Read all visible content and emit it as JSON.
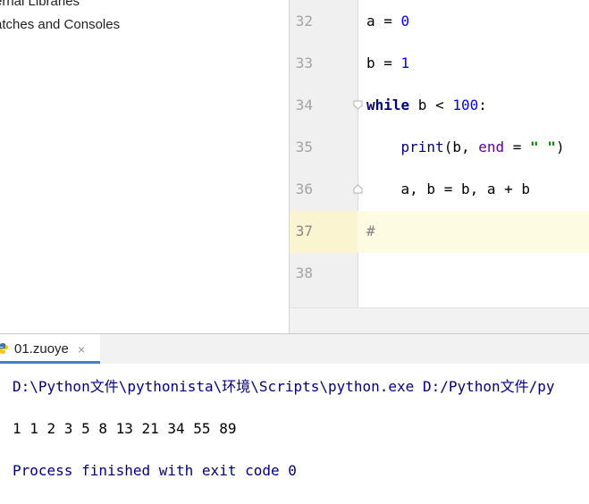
{
  "project_panel": {
    "items": [
      {
        "label": "ernal Libraries"
      },
      {
        "label": "atches and Consoles"
      }
    ]
  },
  "editor": {
    "lines": [
      {
        "number": "32",
        "tokens": [
          {
            "t": "a = ",
            "c": ""
          },
          {
            "t": "0",
            "c": "num"
          }
        ]
      },
      {
        "number": "33",
        "tokens": [
          {
            "t": "b = ",
            "c": ""
          },
          {
            "t": "1",
            "c": "num"
          }
        ]
      },
      {
        "number": "34",
        "tokens": [
          {
            "t": "while",
            "c": "kw"
          },
          {
            "t": " b < ",
            "c": ""
          },
          {
            "t": "100",
            "c": "num"
          },
          {
            "t": ":",
            "c": ""
          }
        ]
      },
      {
        "number": "35",
        "tokens": [
          {
            "t": "    ",
            "c": ""
          },
          {
            "t": "print",
            "c": "bi"
          },
          {
            "t": "(b, ",
            "c": ""
          },
          {
            "t": "end",
            "c": "kwarg"
          },
          {
            "t": " = ",
            "c": ""
          },
          {
            "t": "\" \"",
            "c": "str"
          },
          {
            "t": ")",
            "c": ""
          }
        ]
      },
      {
        "number": "36",
        "tokens": [
          {
            "t": "    a, b = b, a + b",
            "c": ""
          }
        ]
      },
      {
        "number": "37",
        "tokens": [
          {
            "t": "#",
            "c": "cmt"
          }
        ]
      },
      {
        "number": "38",
        "tokens": []
      }
    ]
  },
  "run_window": {
    "tab_label": "01.zuoye",
    "tab_close": "×",
    "output": {
      "command": "D:\\Python文件\\pythonista\\环境\\Scripts\\python.exe D:/Python文件/py",
      "result": "1 1 2 3 5 8 13 21 34 55 89",
      "exit": "Process finished with exit code 0"
    }
  },
  "colors": {
    "keyword": "#000080",
    "number": "#0000ff",
    "string": "#008000",
    "kwarg": "#660099",
    "comment": "#808080",
    "caret_row": "#fefbe3",
    "tab_underline": "#4083c9"
  },
  "icons": {
    "run_tab": "python-icon",
    "fold_start": "fold-open-icon",
    "fold_end": "fold-end-icon"
  }
}
